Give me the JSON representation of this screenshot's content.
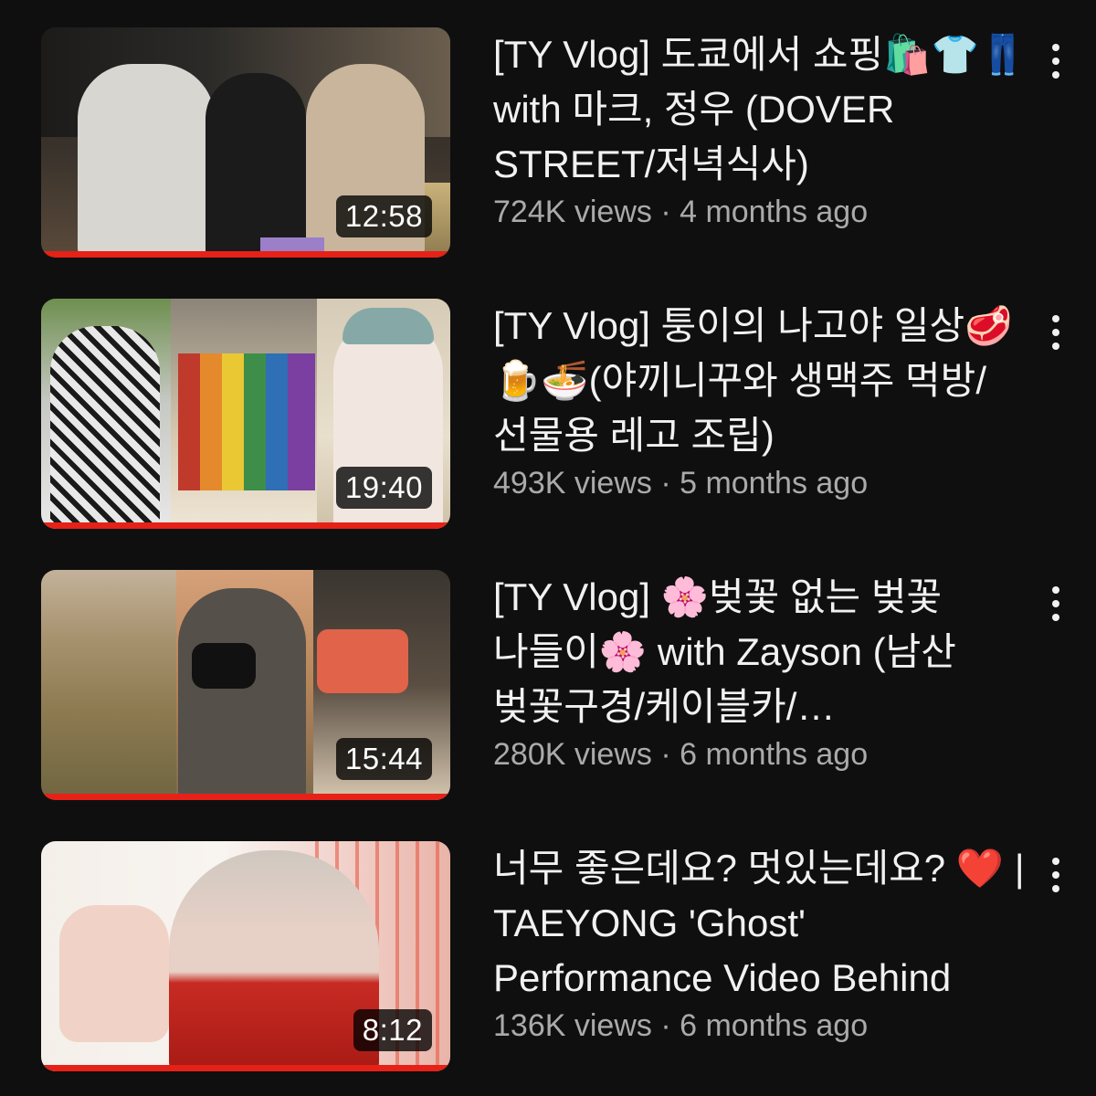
{
  "videos": [
    {
      "title": "[TY Vlog] 도쿄에서 쇼핑🛍️👕👖 with 마크, 정우 (DOVER STREET/저녁식사)",
      "duration": "12:58",
      "views": "724K views",
      "age": "4 months ago",
      "watched_progress": 1.0
    },
    {
      "title": "[TY Vlog] 퉁이의 나고야 일상🥩🍺🍜(야끼니꾸와 생맥주 먹방/선물용 레고 조립)",
      "duration": "19:40",
      "views": "493K views",
      "age": "5 months ago",
      "watched_progress": 1.0
    },
    {
      "title": "[TY Vlog] 🌸벚꽃 없는 벚꽃 나들이🌸 with Zayson (남산 벚꽃구경/케이블카/…",
      "duration": "15:44",
      "views": "280K views",
      "age": "6 months ago",
      "watched_progress": 1.0
    },
    {
      "title": "너무 좋은데요? 멋있는데요? ❤️ | TAEYONG 'Ghost' Performance Video Behind",
      "duration": "8:12",
      "views": "136K views",
      "age": "6 months ago",
      "watched_progress": 1.0
    }
  ],
  "meta_separator": " · ",
  "icons": {
    "menu": "more-vert-icon"
  },
  "colors": {
    "background": "#0f0f0f",
    "title": "#f1f1f1",
    "meta": "#aaaaaa",
    "progress": "#e62117"
  }
}
